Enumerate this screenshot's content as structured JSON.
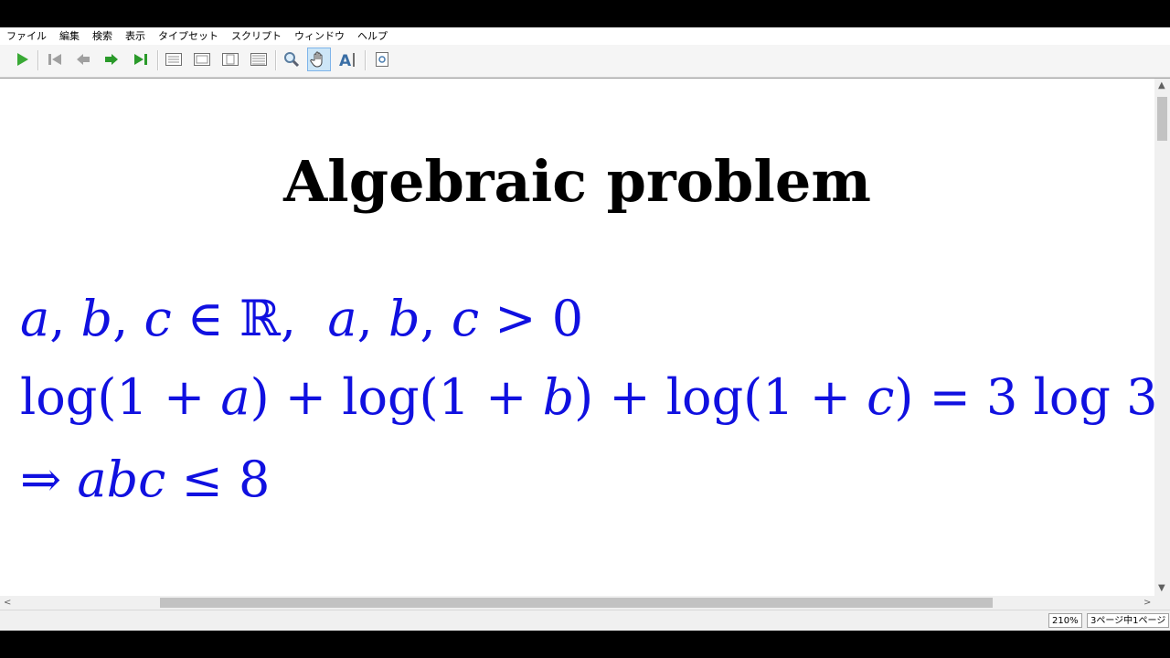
{
  "menu": [
    "ファイル",
    "編集",
    "検索",
    "表示",
    "タイプセット",
    "スクリプト",
    "ウィンドウ",
    "ヘルプ"
  ],
  "toolbar": {
    "icons": [
      "play-icon",
      "first-page-icon",
      "prev-page-icon",
      "next-page-icon",
      "last-page-icon",
      "layout-single-icon",
      "layout-continuous-icon",
      "layout-facing-icon",
      "layout-fit-icon",
      "magnify-icon",
      "hand-tool-icon",
      "text-select-icon",
      "search-doc-icon"
    ],
    "active": "hand-tool-icon"
  },
  "document": {
    "title": "Algebraic problem",
    "lines": [
      "a, b, c ∈ ℝ,  a, b, c > 0",
      "log(1 + a) + log(1 + b) + log(1 + c) = 3 log 3",
      "⇒ abc ≤ 8"
    ],
    "math_color": "#1010e0"
  },
  "status": {
    "zoom": "210%",
    "page": "3ページ中1ページ"
  }
}
